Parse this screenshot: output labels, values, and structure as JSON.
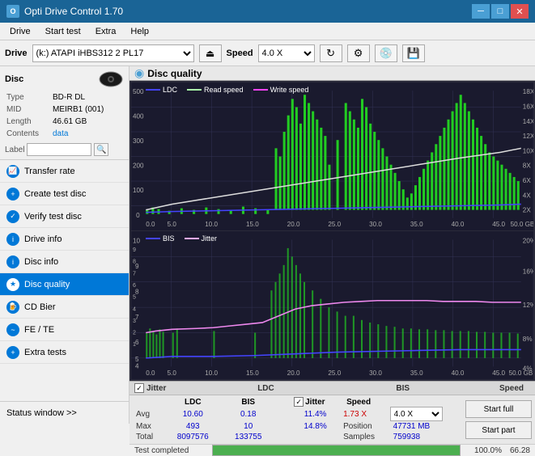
{
  "titleBar": {
    "title": "Opti Drive Control 1.70",
    "minBtn": "─",
    "maxBtn": "□",
    "closeBtn": "✕"
  },
  "menuBar": {
    "items": [
      "Drive",
      "Start test",
      "Extra",
      "Help"
    ]
  },
  "driveBar": {
    "label": "Drive",
    "driveValue": "(k:) ATAPI iHBS312  2 PL17",
    "speedLabel": "Speed",
    "speedValue": "4.0 X"
  },
  "sidebar": {
    "discTitle": "Disc",
    "discInfo": {
      "type": {
        "label": "Type",
        "value": "BD-R DL"
      },
      "mid": {
        "label": "MID",
        "value": "MEIRB1 (001)"
      },
      "length": {
        "label": "Length",
        "value": "46.61 GB"
      },
      "contents": {
        "label": "Contents",
        "value": "data"
      },
      "label": {
        "label": "Label",
        "value": ""
      }
    },
    "navItems": [
      {
        "id": "transfer-rate",
        "label": "Transfer rate",
        "active": false
      },
      {
        "id": "create-test-disc",
        "label": "Create test disc",
        "active": false
      },
      {
        "id": "verify-test-disc",
        "label": "Verify test disc",
        "active": false
      },
      {
        "id": "drive-info",
        "label": "Drive info",
        "active": false
      },
      {
        "id": "disc-info",
        "label": "Disc info",
        "active": false
      },
      {
        "id": "disc-quality",
        "label": "Disc quality",
        "active": true
      },
      {
        "id": "cd-bier",
        "label": "CD Bier",
        "active": false
      },
      {
        "id": "fe-te",
        "label": "FE / TE",
        "active": false
      },
      {
        "id": "extra-tests",
        "label": "Extra tests",
        "active": false
      }
    ],
    "statusWindow": "Status window >> "
  },
  "chartHeader": {
    "title": "Disc quality"
  },
  "chart1": {
    "legend": [
      {
        "label": "LDC",
        "color": "#4444ff"
      },
      {
        "label": "Read speed",
        "color": "#aaffaa"
      },
      {
        "label": "Write speed",
        "color": "#ff44ff"
      }
    ],
    "yAxisMax": 500,
    "yAxisRight": [
      "18X",
      "16X",
      "14X",
      "12X",
      "10X",
      "8X",
      "6X",
      "4X",
      "2X"
    ],
    "xAxisMax": 50
  },
  "chart2": {
    "legend": [
      {
        "label": "BIS",
        "color": "#4444ff"
      },
      {
        "label": "Jitter",
        "color": "#ffaaff"
      }
    ],
    "yAxisMax": 10,
    "yAxisRight": [
      "20%",
      "16%",
      "12%",
      "8%",
      "4%"
    ],
    "xAxisMax": 50
  },
  "statsBar": {
    "columns": {
      "headers": [
        "LDC",
        "BIS",
        "",
        "Jitter",
        "Speed",
        ""
      ],
      "avg": {
        "label": "Avg",
        "ldc": "10.60",
        "bis": "0.18",
        "jitter": "11.4%",
        "speed": "1.73 X",
        "speedSelect": "4.0 X"
      },
      "max": {
        "label": "Max",
        "ldc": "493",
        "bis": "10",
        "jitter": "14.8%",
        "position": "47731 MB"
      },
      "total": {
        "label": "Total",
        "ldc": "8097576",
        "bis": "133755",
        "samples": "759938"
      }
    },
    "jitterChecked": true,
    "startFull": "Start full",
    "startPart": "Start part",
    "positionLabel": "Position",
    "samplesLabel": "Samples"
  },
  "progressBar": {
    "label": "Test completed",
    "percentage": 100,
    "percentageText": "100.0%",
    "extra": "66.28"
  },
  "colors": {
    "accent": "#0078d7",
    "green": "#4caf50",
    "chartBg": "#1a1a2a",
    "gridLine": "#333355"
  }
}
